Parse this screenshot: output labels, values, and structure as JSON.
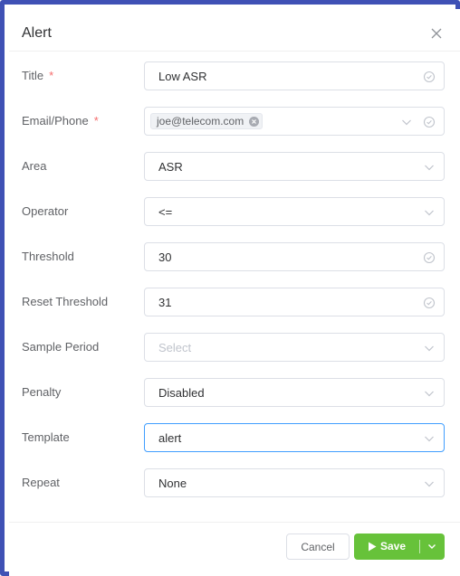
{
  "dialog": {
    "title": "Alert",
    "colors": {
      "frame": "#3f51b5",
      "primary_focus": "#409eff",
      "save": "#67c23a",
      "required": "#f56c6c"
    }
  },
  "form": {
    "title": {
      "label": "Title",
      "required_mark": "*",
      "value": "Low ASR"
    },
    "email": {
      "label": "Email/Phone",
      "required_mark": "*",
      "tag": "joe@telecom.com"
    },
    "area": {
      "label": "Area",
      "value": "ASR"
    },
    "operator": {
      "label": "Operator",
      "value": "<="
    },
    "threshold": {
      "label": "Threshold",
      "value": "30"
    },
    "reset_threshold": {
      "label": "Reset Threshold",
      "value": "31"
    },
    "sample_period": {
      "label": "Sample Period",
      "placeholder": "Select"
    },
    "penalty": {
      "label": "Penalty",
      "value": "Disabled"
    },
    "template": {
      "label": "Template",
      "value": "alert"
    },
    "repeat": {
      "label": "Repeat",
      "value": "None"
    }
  },
  "footer": {
    "cancel_label": "Cancel",
    "save_label": "Save"
  },
  "icons": [
    "close-icon",
    "check-circle-icon",
    "chevron-down-icon",
    "tag-close-icon",
    "play-icon",
    "caret-down-icon"
  ]
}
